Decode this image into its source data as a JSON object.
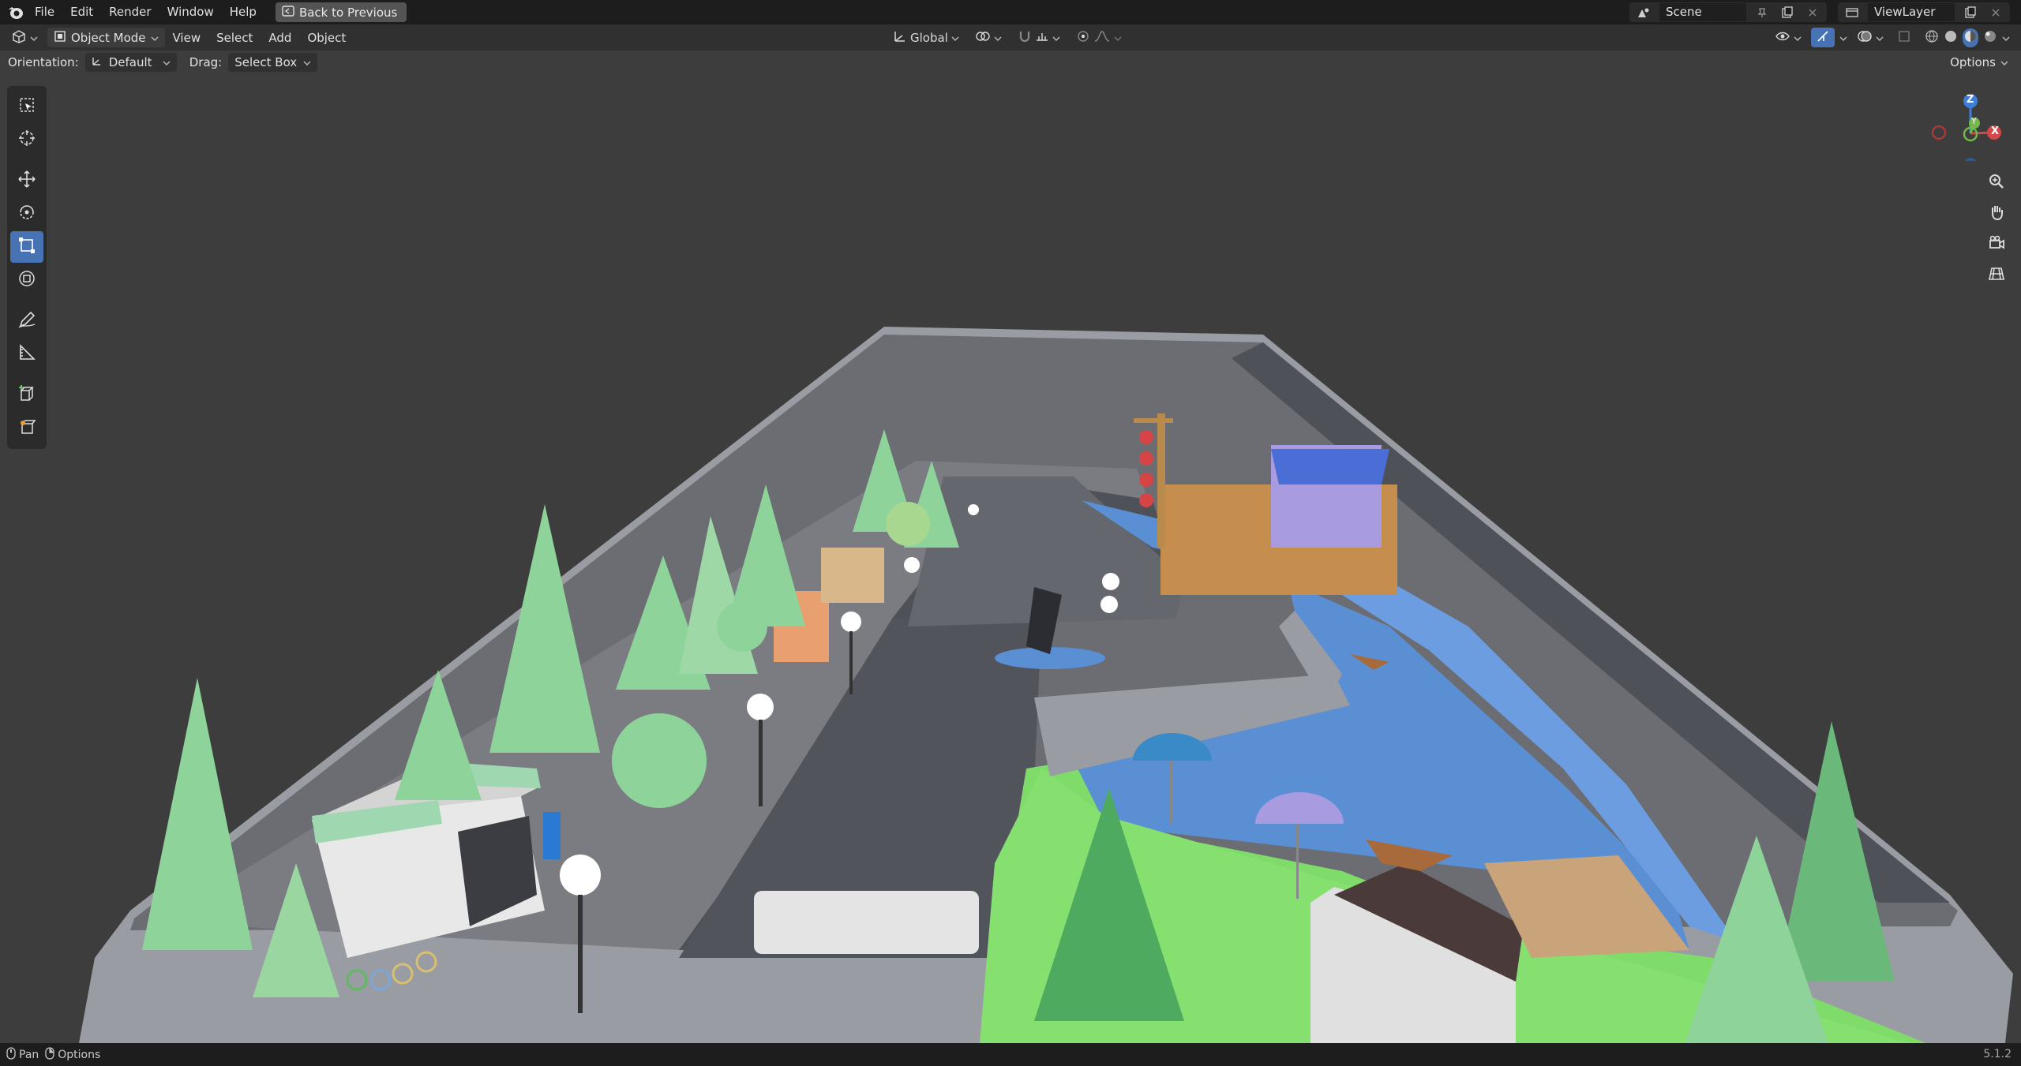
{
  "topbar": {
    "menus": [
      "File",
      "Edit",
      "Render",
      "Window",
      "Help"
    ],
    "back_button": "Back to Previous",
    "scene": "Scene",
    "view_layer": "ViewLayer"
  },
  "header": {
    "mode": "Object Mode",
    "menus": [
      "View",
      "Select",
      "Add",
      "Object"
    ],
    "transform_orientation": "Global"
  },
  "tool_settings": {
    "orientation_label": "Orientation:",
    "orientation_value": "Default",
    "drag_label": "Drag:",
    "drag_value": "Select Box",
    "options_label": "Options"
  },
  "gizmo": {
    "z": "Z",
    "y": "Y",
    "x": "X"
  },
  "statusbar": {
    "pan": "Pan",
    "options": "Options",
    "version": "5.1.2"
  },
  "colors": {
    "accent": "#4772b3",
    "viewport_bg": "#3d3d3d",
    "water": "#5a8fd4",
    "grass": "#7fdc6a",
    "road": "#5e6068"
  }
}
